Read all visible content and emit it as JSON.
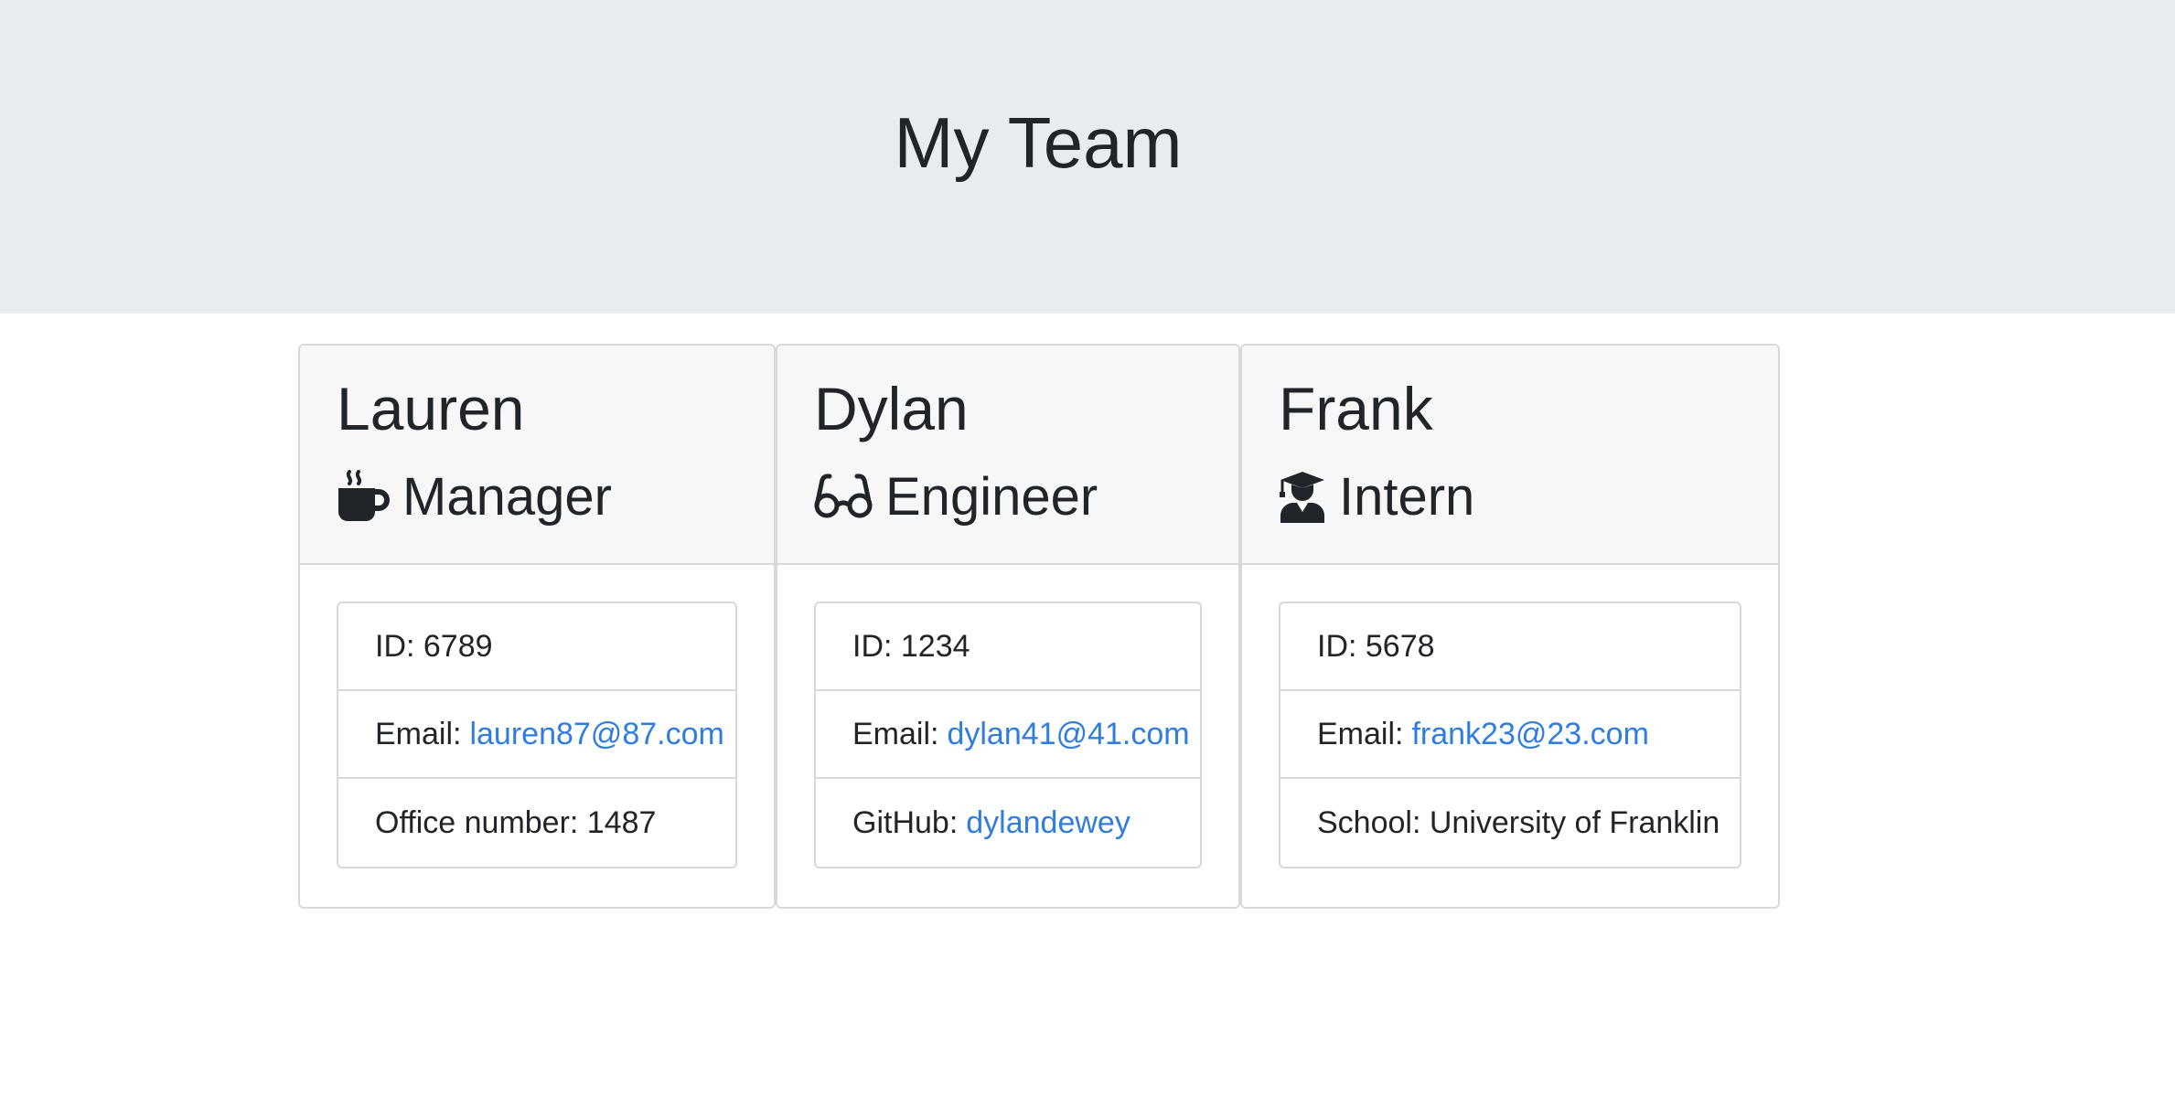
{
  "header": {
    "title": "My Team"
  },
  "colors": {
    "jumbotron_bg": "#e9ecef",
    "card_header_bg": "#f7f7f7",
    "link": "#2f7de1",
    "text": "#212529"
  },
  "cards": [
    {
      "name": "Lauren",
      "role": "Manager",
      "role_icon": "coffee-mug-icon",
      "id_text": "ID: 6789",
      "email_label": "Email:",
      "email": "lauren87@87.com",
      "extra_label": "Office number: 1487",
      "extra_link": ""
    },
    {
      "name": "Dylan",
      "role": "Engineer",
      "role_icon": "glasses-icon",
      "id_text": "ID: 1234",
      "email_label": "Email:",
      "email": "dylan41@41.com",
      "extra_label": "GitHub:",
      "extra_link": "dylandewey"
    },
    {
      "name": "Frank",
      "role": "Intern",
      "role_icon": "graduate-icon",
      "id_text": "ID: 5678",
      "email_label": "Email:",
      "email": "frank23@23.com",
      "extra_label": "School: University of Franklin",
      "extra_link": ""
    }
  ]
}
